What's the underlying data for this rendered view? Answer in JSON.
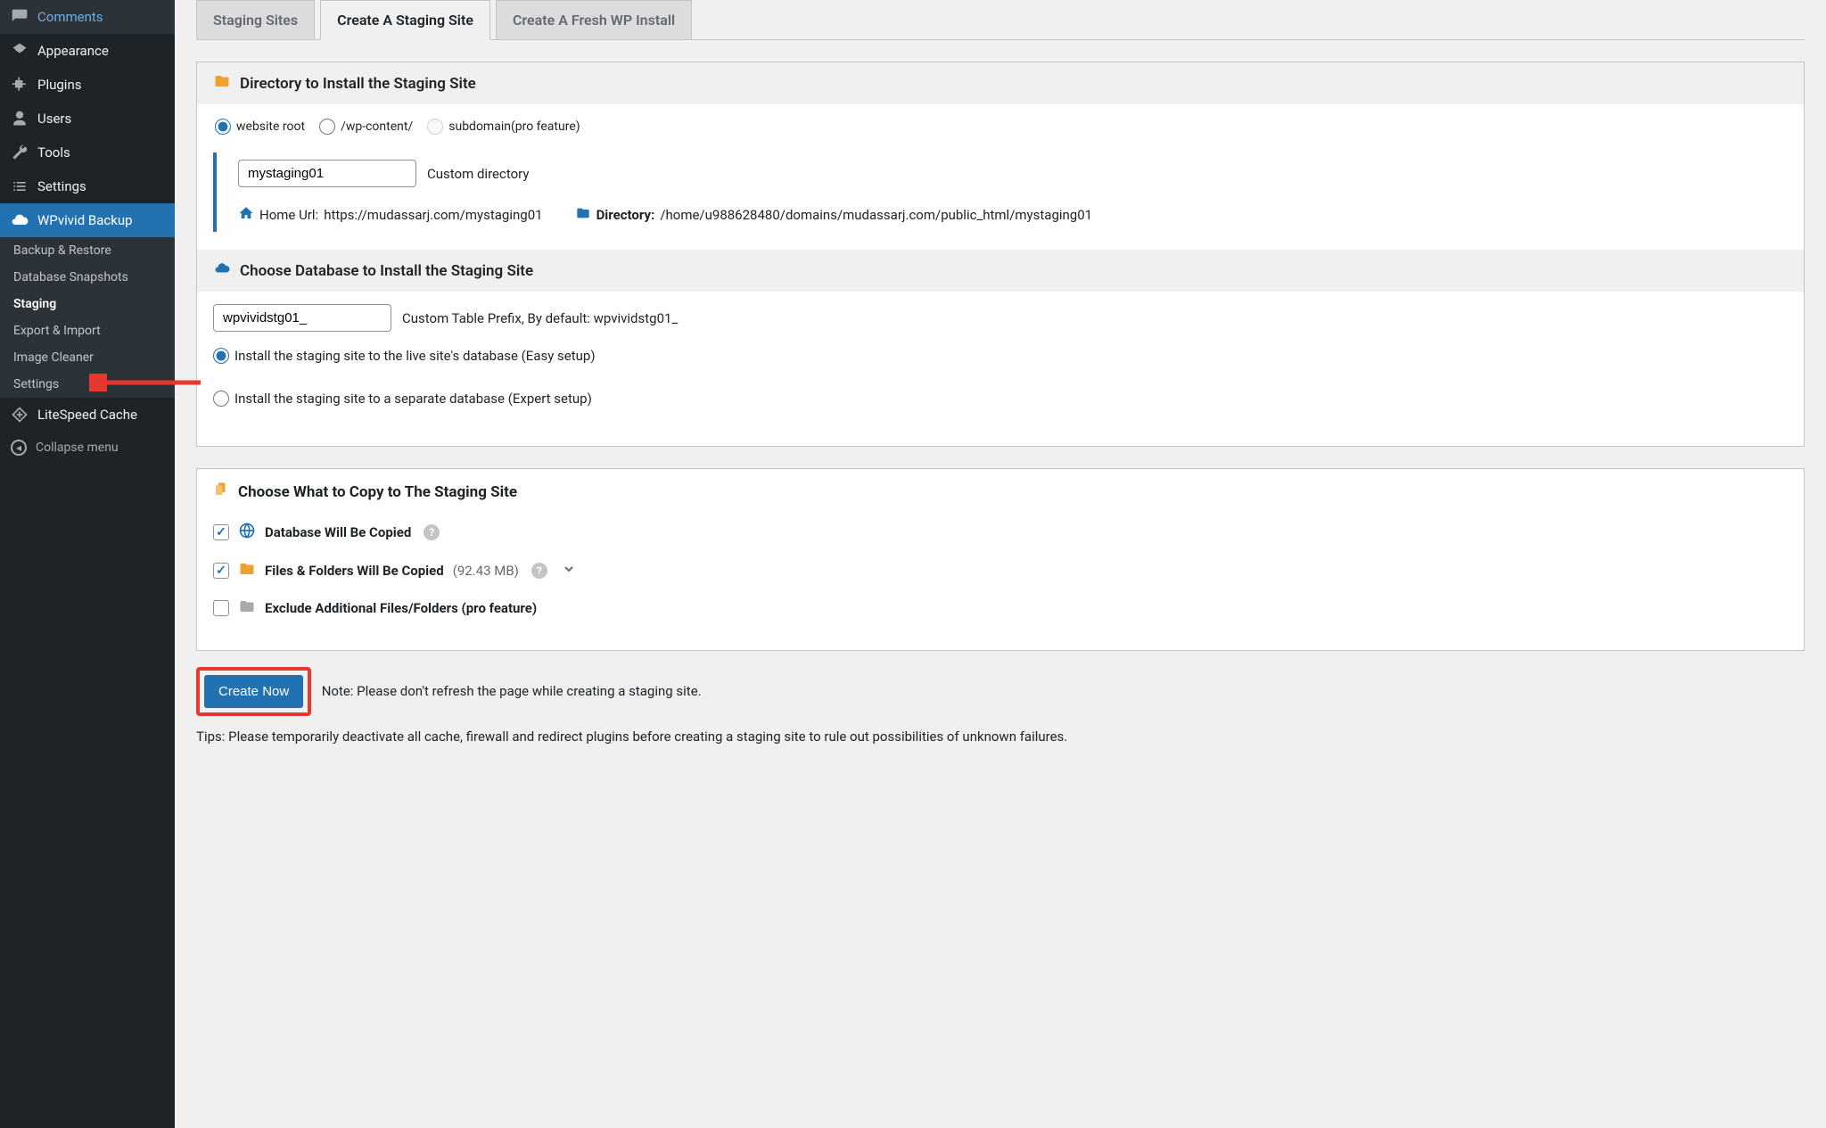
{
  "sidebar": {
    "items": [
      {
        "label": "Comments"
      },
      {
        "label": "Appearance"
      },
      {
        "label": "Plugins"
      },
      {
        "label": "Users"
      },
      {
        "label": "Tools"
      },
      {
        "label": "Settings"
      },
      {
        "label": "WPvivid Backup"
      },
      {
        "label": "LiteSpeed Cache"
      }
    ],
    "sub": [
      {
        "label": "Backup & Restore"
      },
      {
        "label": "Database Snapshots"
      },
      {
        "label": "Staging"
      },
      {
        "label": "Export & Import"
      },
      {
        "label": "Image Cleaner"
      },
      {
        "label": "Settings"
      }
    ],
    "collapse": "Collapse menu"
  },
  "tabs": {
    "staging_sites": "Staging Sites",
    "create_staging": "Create A Staging Site",
    "fresh_install": "Create A Fresh WP Install"
  },
  "dir": {
    "heading": "Directory to Install the Staging Site",
    "opt_root": "website root",
    "opt_wpcontent": "/wp-content/",
    "opt_subdomain": "subdomain(pro feature)",
    "custom_dir_value": "mystaging01",
    "custom_dir_label": "Custom directory",
    "home_label": "Home Url:",
    "home_url": "https://mudassarj.com/mystaging01",
    "directory_label": "Directory:",
    "directory_path": "/home/u988628480/domains/mudassarj.com/public_html/mystaging01"
  },
  "db": {
    "heading": "Choose Database to Install the Staging Site",
    "prefix_value": "wpvividstg01_",
    "prefix_label": "Custom Table Prefix, By default: wpvividstg01_",
    "opt_live": "Install the staging site to the live site's database (Easy setup)",
    "opt_separate": "Install the staging site to a separate database (Expert setup)"
  },
  "copy": {
    "heading": "Choose What to Copy to The Staging Site",
    "db_copied": "Database Will Be Copied",
    "files_copied": "Files & Folders Will Be Copied",
    "files_size": "(92.43 MB)",
    "exclude": "Exclude Additional Files/Folders (pro feature)"
  },
  "bottom": {
    "create": "Create Now",
    "note": "Note: Please don't refresh the page while creating a staging site.",
    "tips": "Tips: Please temporarily deactivate all cache, firewall and redirect plugins before creating a staging site to rule out possibilities of unknown failures."
  }
}
